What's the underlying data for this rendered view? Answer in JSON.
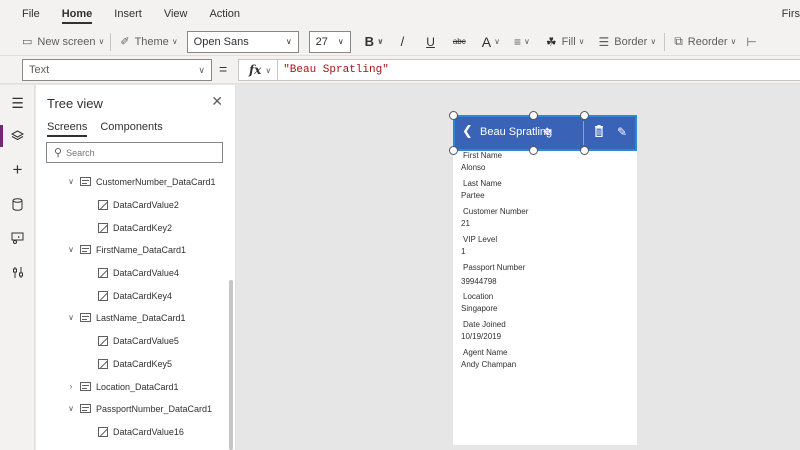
{
  "menubar": {
    "items": [
      "File",
      "Home",
      "Insert",
      "View",
      "Action"
    ],
    "active": "Home",
    "right_text": "Firs"
  },
  "toolbar": {
    "new_screen": "New screen",
    "theme": "Theme",
    "font": "Open Sans",
    "font_size": "27",
    "bold": "B",
    "italic": "/",
    "underline": "U",
    "strike": "abc",
    "font_color": "A",
    "fill": "Fill",
    "border": "Border",
    "reorder": "Reorder"
  },
  "formula_bar": {
    "property": "Text",
    "equals": "=",
    "fx": "fx",
    "formula": "\"Beau Spratling\""
  },
  "tree_view": {
    "title": "Tree view",
    "tabs": [
      "Screens",
      "Components"
    ],
    "active_tab": "Screens",
    "search_placeholder": "Search",
    "items": [
      {
        "label": "CustomerNumber_DataCard1",
        "type": "card",
        "level": 0
      },
      {
        "label": "DataCardValue2",
        "type": "edit",
        "level": 1
      },
      {
        "label": "DataCardKey2",
        "type": "edit",
        "level": 1
      },
      {
        "label": "FirstName_DataCard1",
        "type": "card",
        "level": 0
      },
      {
        "label": "DataCardValue4",
        "type": "edit",
        "level": 1
      },
      {
        "label": "DataCardKey4",
        "type": "edit",
        "level": 1
      },
      {
        "label": "LastName_DataCard1",
        "type": "card",
        "level": 0
      },
      {
        "label": "DataCardValue5",
        "type": "edit",
        "level": 1
      },
      {
        "label": "DataCardKey5",
        "type": "edit",
        "level": 1
      },
      {
        "label": "Location_DataCard1",
        "type": "card",
        "level": 0,
        "collapsed": true
      },
      {
        "label": "PassportNumber_DataCard1",
        "type": "card",
        "level": 0
      },
      {
        "label": "DataCardValue16",
        "type": "edit",
        "level": 1
      }
    ]
  },
  "app_screen": {
    "header_title": "Beau Spratling",
    "fields": [
      {
        "label": "First Name",
        "value": "Alonso"
      },
      {
        "label": "Last Name",
        "value": "Partee"
      },
      {
        "label": "Customer Number",
        "value": "21"
      },
      {
        "label": "VIP Level",
        "value": "1"
      },
      {
        "label": "Passport Number",
        "value": "39944798"
      },
      {
        "label": "Location",
        "value": "Singapore"
      },
      {
        "label": "Date Joined",
        "value": "10/19/2019"
      },
      {
        "label": "Agent Name",
        "value": "Andy Champan"
      }
    ]
  },
  "colors": {
    "header_bg": "#3a63b8",
    "selection_border": "#2b88d8",
    "rail_accent": "#742774",
    "formula_text": "#a31515"
  }
}
